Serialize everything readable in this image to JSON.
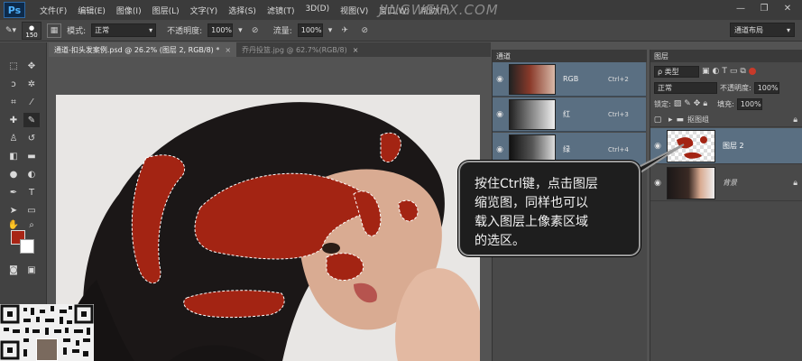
{
  "app": {
    "logo": "Ps",
    "watermark": "JINGWEIPX.COM"
  },
  "menu": {
    "items": [
      "文件(F)",
      "编辑(E)",
      "图像(I)",
      "图层(L)",
      "文字(Y)",
      "选择(S)",
      "滤镜(T)",
      "3D(D)",
      "视图(V)",
      "窗口(W)",
      "帮助(H)"
    ]
  },
  "window_controls": [
    "—",
    "❐",
    "✕"
  ],
  "options_bar": {
    "brush_size": "150",
    "mode_label": "模式:",
    "mode_value": "正常",
    "opacity_label": "不透明度:",
    "opacity_value": "100%",
    "flow_label": "流量:",
    "flow_value": "100%",
    "workspace": "通道布局"
  },
  "tabs": [
    {
      "label": "通道-扣头发案例.psd @ 26.2% (图层 2, RGB/8) *",
      "active": true
    },
    {
      "label": "乔丹投篮.jpg @ 62.7%(RGB/8)",
      "active": false
    }
  ],
  "channels_panel": {
    "title": "通道",
    "rows": [
      {
        "name": "RGB",
        "shortcut": "Ctrl+2"
      },
      {
        "name": "红",
        "shortcut": "Ctrl+3"
      },
      {
        "name": "绿",
        "shortcut": "Ctrl+4"
      }
    ]
  },
  "layers_panel": {
    "title": "图层",
    "filter_value": "ρ 类型",
    "blend_mode": "正常",
    "opacity_label": "不透明度:",
    "opacity_value": "100%",
    "lock_label": "锁定:",
    "fill_label": "填充:",
    "fill_value": "100%",
    "layers": [
      {
        "name": "抠图组",
        "type": "group"
      },
      {
        "name": "图层 2",
        "type": "layer",
        "selected": true
      },
      {
        "name": "背景",
        "type": "background"
      }
    ]
  },
  "callout": {
    "lines": [
      "按住Ctrl键，点击图层",
      "缩览图，同样也可以",
      "载入图层上像素区域",
      "的选区。"
    ]
  },
  "colors": {
    "foreground": "#a82516",
    "background": "#ffffff",
    "selection_red": "#a32413",
    "panel_selected": "#5a6f82"
  }
}
